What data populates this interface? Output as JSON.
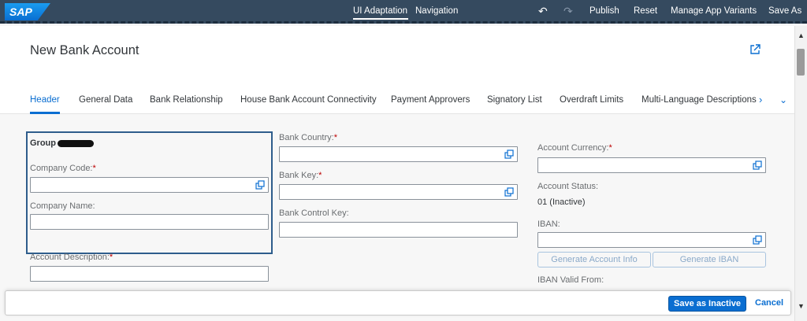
{
  "topbar": {
    "logo": "SAP",
    "ui_adaptation": "UI Adaptation",
    "navigation": "Navigation",
    "undo_icon": "↶",
    "redo_icon": "↷",
    "publish": "Publish",
    "reset": "Reset",
    "manage_app_variants": "Manage App Variants",
    "save_as": "Save As"
  },
  "header": {
    "title": "New Bank Account",
    "tabs": [
      {
        "label": "Header",
        "active": true
      },
      {
        "label": "General Data"
      },
      {
        "label": "Bank Relationship"
      },
      {
        "label": "House Bank Account Connectivity"
      },
      {
        "label": "Payment Approvers"
      },
      {
        "label": "Signatory List"
      },
      {
        "label": "Overdraft Limits"
      },
      {
        "label": "Multi-Language Descriptions"
      }
    ],
    "next_icon": "›",
    "more_icon": "⌄"
  },
  "form": {
    "group_title": "Group",
    "company_code_label": "Company Code:",
    "company_name_label": "Company Name:",
    "account_description_label": "Account Description:",
    "bank_country_label": "Bank Country:",
    "bank_key_label": "Bank Key:",
    "bank_control_key_label": "Bank Control Key:",
    "account_currency_label": "Account Currency:",
    "account_status_label": "Account Status:",
    "account_status_value": "01 (Inactive)",
    "iban_label": "IBAN:",
    "generate_account_info": "Generate Account Info",
    "generate_iban": "Generate IBAN",
    "iban_valid_from_label": "IBAN Valid From:",
    "required_marker": "*"
  },
  "footer": {
    "save_as_inactive": "Save as Inactive",
    "cancel": "Cancel"
  },
  "colors": {
    "shell": "#354a5f",
    "accent": "#0a6ed1",
    "required": "#bb0000"
  }
}
